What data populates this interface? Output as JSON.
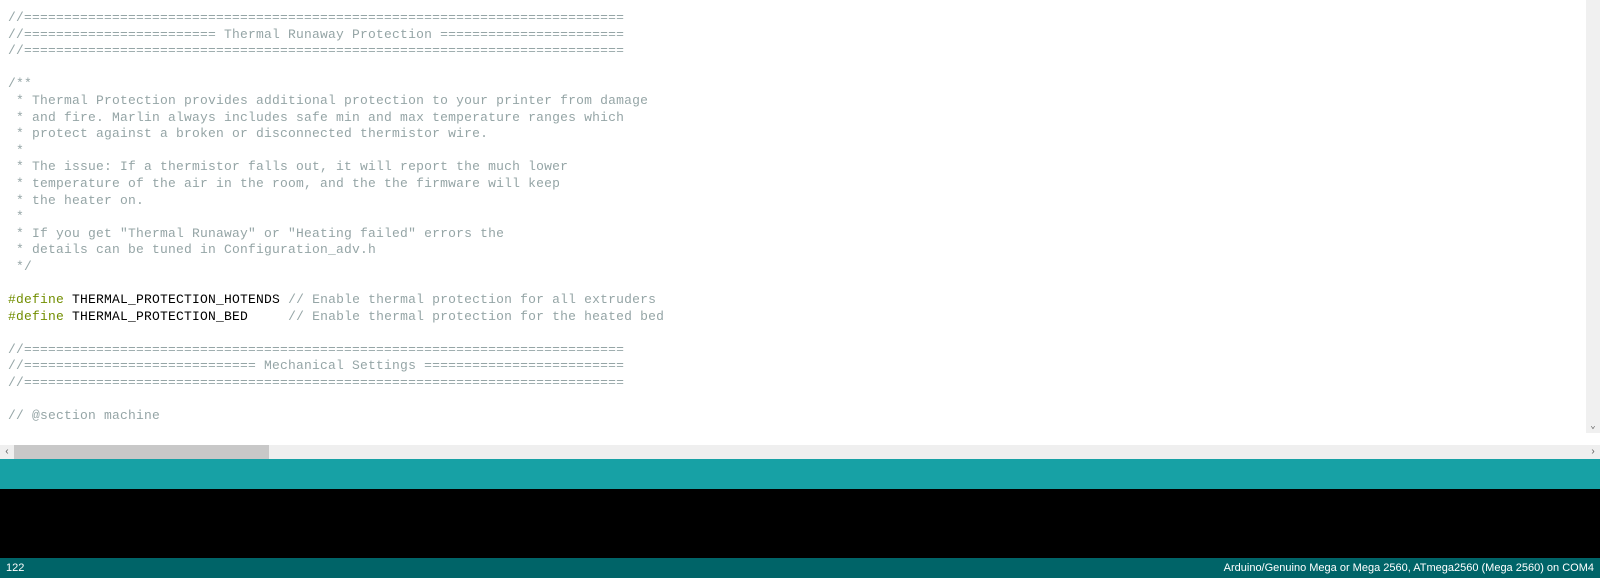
{
  "code_lines": [
    {
      "t": "comment",
      "text": "//==========================================================================="
    },
    {
      "t": "comment",
      "text": "//======================== Thermal Runaway Protection ======================="
    },
    {
      "t": "comment",
      "text": "//==========================================================================="
    },
    {
      "t": "blank",
      "text": ""
    },
    {
      "t": "comment",
      "text": "/**"
    },
    {
      "t": "comment",
      "text": " * Thermal Protection provides additional protection to your printer from damage"
    },
    {
      "t": "comment",
      "text": " * and fire. Marlin always includes safe min and max temperature ranges which"
    },
    {
      "t": "comment",
      "text": " * protect against a broken or disconnected thermistor wire."
    },
    {
      "t": "comment",
      "text": " *"
    },
    {
      "t": "comment",
      "text": " * The issue: If a thermistor falls out, it will report the much lower"
    },
    {
      "t": "comment",
      "text": " * temperature of the air in the room, and the the firmware will keep"
    },
    {
      "t": "comment",
      "text": " * the heater on."
    },
    {
      "t": "comment",
      "text": " *"
    },
    {
      "t": "comment",
      "text": " * If you get \"Thermal Runaway\" or \"Heating failed\" errors the"
    },
    {
      "t": "comment",
      "text": " * details can be tuned in Configuration_adv.h"
    },
    {
      "t": "comment",
      "text": " */"
    },
    {
      "t": "blank",
      "text": ""
    },
    {
      "t": "define",
      "kw": "#define",
      "ident": " THERMAL_PROTECTION_HOTENDS ",
      "trail": "// Enable thermal protection for all extruders"
    },
    {
      "t": "define",
      "kw": "#define",
      "ident": " THERMAL_PROTECTION_BED     ",
      "trail": "// Enable thermal protection for the heated bed"
    },
    {
      "t": "blank",
      "text": ""
    },
    {
      "t": "comment",
      "text": "//==========================================================================="
    },
    {
      "t": "comment",
      "text": "//============================= Mechanical Settings ========================="
    },
    {
      "t": "comment",
      "text": "//==========================================================================="
    },
    {
      "t": "blank",
      "text": ""
    },
    {
      "t": "comment",
      "text": "// @section machine"
    }
  ],
  "scroll": {
    "left_arrow": "‹",
    "right_arrow": "›",
    "down_arrow": "⌄"
  },
  "status": {
    "line_number": "122",
    "board_info": "Arduino/Genuino Mega or Mega 2560, ATmega2560 (Mega 2560) on COM4"
  }
}
